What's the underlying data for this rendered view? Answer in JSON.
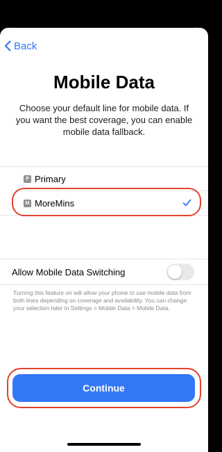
{
  "header": {
    "back_label": "Back"
  },
  "main": {
    "title": "Mobile Data",
    "subtitle": "Choose your default line for mobile data. If you want the best coverage, you can enable mobile data fallback."
  },
  "lines": [
    {
      "badge": "P",
      "label": "Primary",
      "selected": false
    },
    {
      "badge": "M",
      "label": "MoreMins",
      "selected": true
    }
  ],
  "switching": {
    "label": "Allow Mobile Data Switching",
    "enabled": false,
    "footnote": "Turning this feature on will allow your phone to use mobile data from both lines depending on coverage and availability. You can change your selection later in Settings > Mobile Data > Mobile Data."
  },
  "footer": {
    "continue_label": "Continue"
  },
  "colors": {
    "accent": "#3478f6",
    "highlight": "#e0432b",
    "toggle_off": "#e9e9ea"
  },
  "icons": {
    "back": "chevron-left-icon",
    "check": "checkmark-icon"
  }
}
